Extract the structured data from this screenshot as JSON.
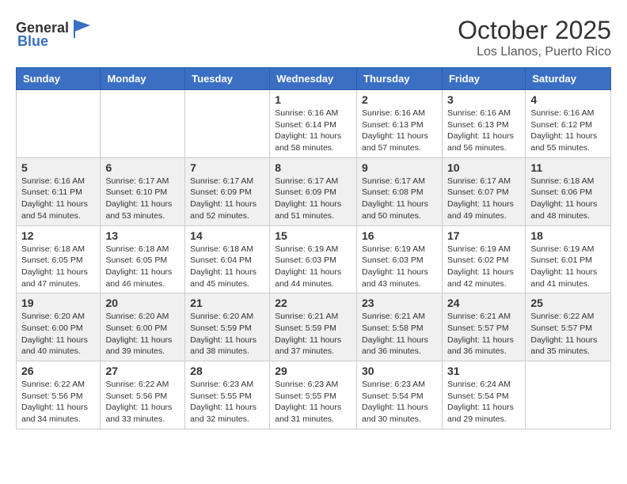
{
  "header": {
    "logo_general": "General",
    "logo_blue": "Blue",
    "month": "October 2025",
    "location": "Los Llanos, Puerto Rico"
  },
  "weekdays": [
    "Sunday",
    "Monday",
    "Tuesday",
    "Wednesday",
    "Thursday",
    "Friday",
    "Saturday"
  ],
  "weeks": [
    [
      {
        "day": "",
        "info": ""
      },
      {
        "day": "",
        "info": ""
      },
      {
        "day": "",
        "info": ""
      },
      {
        "day": "1",
        "info": "Sunrise: 6:16 AM\nSunset: 6:14 PM\nDaylight: 11 hours and 58 minutes."
      },
      {
        "day": "2",
        "info": "Sunrise: 6:16 AM\nSunset: 6:13 PM\nDaylight: 11 hours and 57 minutes."
      },
      {
        "day": "3",
        "info": "Sunrise: 6:16 AM\nSunset: 6:13 PM\nDaylight: 11 hours and 56 minutes."
      },
      {
        "day": "4",
        "info": "Sunrise: 6:16 AM\nSunset: 6:12 PM\nDaylight: 11 hours and 55 minutes."
      }
    ],
    [
      {
        "day": "5",
        "info": "Sunrise: 6:16 AM\nSunset: 6:11 PM\nDaylight: 11 hours and 54 minutes."
      },
      {
        "day": "6",
        "info": "Sunrise: 6:17 AM\nSunset: 6:10 PM\nDaylight: 11 hours and 53 minutes."
      },
      {
        "day": "7",
        "info": "Sunrise: 6:17 AM\nSunset: 6:09 PM\nDaylight: 11 hours and 52 minutes."
      },
      {
        "day": "8",
        "info": "Sunrise: 6:17 AM\nSunset: 6:09 PM\nDaylight: 11 hours and 51 minutes."
      },
      {
        "day": "9",
        "info": "Sunrise: 6:17 AM\nSunset: 6:08 PM\nDaylight: 11 hours and 50 minutes."
      },
      {
        "day": "10",
        "info": "Sunrise: 6:17 AM\nSunset: 6:07 PM\nDaylight: 11 hours and 49 minutes."
      },
      {
        "day": "11",
        "info": "Sunrise: 6:18 AM\nSunset: 6:06 PM\nDaylight: 11 hours and 48 minutes."
      }
    ],
    [
      {
        "day": "12",
        "info": "Sunrise: 6:18 AM\nSunset: 6:05 PM\nDaylight: 11 hours and 47 minutes."
      },
      {
        "day": "13",
        "info": "Sunrise: 6:18 AM\nSunset: 6:05 PM\nDaylight: 11 hours and 46 minutes."
      },
      {
        "day": "14",
        "info": "Sunrise: 6:18 AM\nSunset: 6:04 PM\nDaylight: 11 hours and 45 minutes."
      },
      {
        "day": "15",
        "info": "Sunrise: 6:19 AM\nSunset: 6:03 PM\nDaylight: 11 hours and 44 minutes."
      },
      {
        "day": "16",
        "info": "Sunrise: 6:19 AM\nSunset: 6:03 PM\nDaylight: 11 hours and 43 minutes."
      },
      {
        "day": "17",
        "info": "Sunrise: 6:19 AM\nSunset: 6:02 PM\nDaylight: 11 hours and 42 minutes."
      },
      {
        "day": "18",
        "info": "Sunrise: 6:19 AM\nSunset: 6:01 PM\nDaylight: 11 hours and 41 minutes."
      }
    ],
    [
      {
        "day": "19",
        "info": "Sunrise: 6:20 AM\nSunset: 6:00 PM\nDaylight: 11 hours and 40 minutes."
      },
      {
        "day": "20",
        "info": "Sunrise: 6:20 AM\nSunset: 6:00 PM\nDaylight: 11 hours and 39 minutes."
      },
      {
        "day": "21",
        "info": "Sunrise: 6:20 AM\nSunset: 5:59 PM\nDaylight: 11 hours and 38 minutes."
      },
      {
        "day": "22",
        "info": "Sunrise: 6:21 AM\nSunset: 5:59 PM\nDaylight: 11 hours and 37 minutes."
      },
      {
        "day": "23",
        "info": "Sunrise: 6:21 AM\nSunset: 5:58 PM\nDaylight: 11 hours and 36 minutes."
      },
      {
        "day": "24",
        "info": "Sunrise: 6:21 AM\nSunset: 5:57 PM\nDaylight: 11 hours and 36 minutes."
      },
      {
        "day": "25",
        "info": "Sunrise: 6:22 AM\nSunset: 5:57 PM\nDaylight: 11 hours and 35 minutes."
      }
    ],
    [
      {
        "day": "26",
        "info": "Sunrise: 6:22 AM\nSunset: 5:56 PM\nDaylight: 11 hours and 34 minutes."
      },
      {
        "day": "27",
        "info": "Sunrise: 6:22 AM\nSunset: 5:56 PM\nDaylight: 11 hours and 33 minutes."
      },
      {
        "day": "28",
        "info": "Sunrise: 6:23 AM\nSunset: 5:55 PM\nDaylight: 11 hours and 32 minutes."
      },
      {
        "day": "29",
        "info": "Sunrise: 6:23 AM\nSunset: 5:55 PM\nDaylight: 11 hours and 31 minutes."
      },
      {
        "day": "30",
        "info": "Sunrise: 6:23 AM\nSunset: 5:54 PM\nDaylight: 11 hours and 30 minutes."
      },
      {
        "day": "31",
        "info": "Sunrise: 6:24 AM\nSunset: 5:54 PM\nDaylight: 11 hours and 29 minutes."
      },
      {
        "day": "",
        "info": ""
      }
    ]
  ]
}
